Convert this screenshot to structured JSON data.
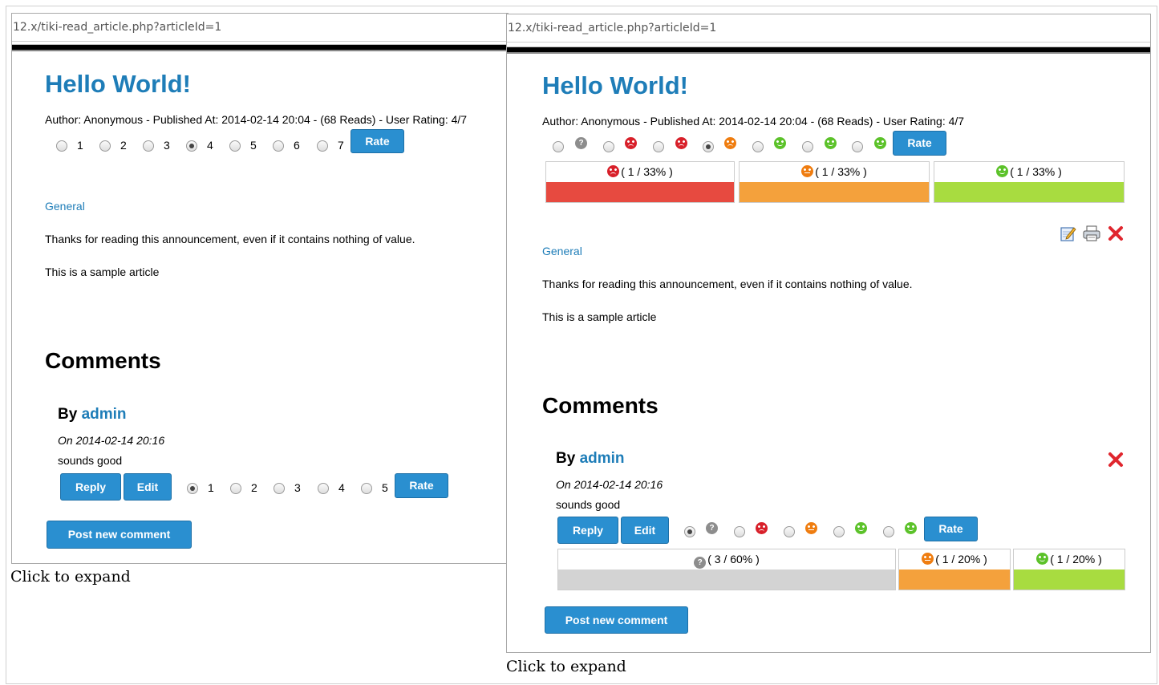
{
  "left": {
    "url": "12.x/tiki-read_article.php?articleId=1",
    "title": "Hello World!",
    "meta": "Author: Anonymous - Published At: 2014-02-14 20:04 - (68 Reads) - User Rating: 4/7",
    "rating_options": [
      "1",
      "2",
      "3",
      "4",
      "5",
      "6",
      "7"
    ],
    "rate_label": "Rate",
    "category": "General",
    "para1": "Thanks for reading this announcement, even if it contains nothing of value.",
    "para2": "This is a sample article",
    "comments_heading": "Comments",
    "comment": {
      "by": "By",
      "author": "admin",
      "date": "On 2014-02-14 20:16",
      "body": "sounds good",
      "reply_label": "Reply",
      "edit_label": "Edit",
      "rating_options": [
        "1",
        "2",
        "3",
        "4",
        "5"
      ],
      "rate_label": "Rate"
    },
    "post_label": "Post new comment",
    "caption": "Click to expand"
  },
  "right": {
    "url": "12.x/tiki-read_article.php?articleId=1",
    "title": "Hello World!",
    "meta": "Author: Anonymous - Published At: 2014-02-14 20:04 - (68 Reads) - User Rating: 4/7",
    "rate_label": "Rate",
    "rating_results": [
      {
        "label": "( 1 / 33% )",
        "face": "frown",
        "color": "#e74a40"
      },
      {
        "label": "( 1 / 33% )",
        "face": "neutral",
        "color": "#f4a13c"
      },
      {
        "label": "( 1 / 33% )",
        "face": "smile",
        "color": "#a8dc40"
      }
    ],
    "category": "General",
    "para1": "Thanks for reading this announcement, even if it contains nothing of value.",
    "para2": "This is a sample article",
    "comments_heading": "Comments",
    "comment": {
      "by": "By",
      "author": "admin",
      "date": "On 2014-02-14 20:16",
      "body": "sounds good",
      "reply_label": "Reply",
      "edit_label": "Edit",
      "rate_label": "Rate",
      "rating_results": [
        {
          "label": "( 3 / 60% )",
          "face": "question",
          "color": "#d3d3d3",
          "share": 0.6
        },
        {
          "label": "( 1 / 20% )",
          "face": "neutral",
          "color": "#f4a13c",
          "share": 0.2
        },
        {
          "label": "( 1 / 20% )",
          "face": "smile",
          "color": "#a8dc40",
          "share": 0.2
        }
      ]
    },
    "post_label": "Post new comment",
    "caption": "Click to expand"
  },
  "colors": {
    "link": "#1e7db8",
    "button": "#2a8fd0",
    "face_grey": "#8d8d8d",
    "face_red": "#d8202a",
    "face_orange": "#ef7d10",
    "face_green": "#5cc22a"
  }
}
